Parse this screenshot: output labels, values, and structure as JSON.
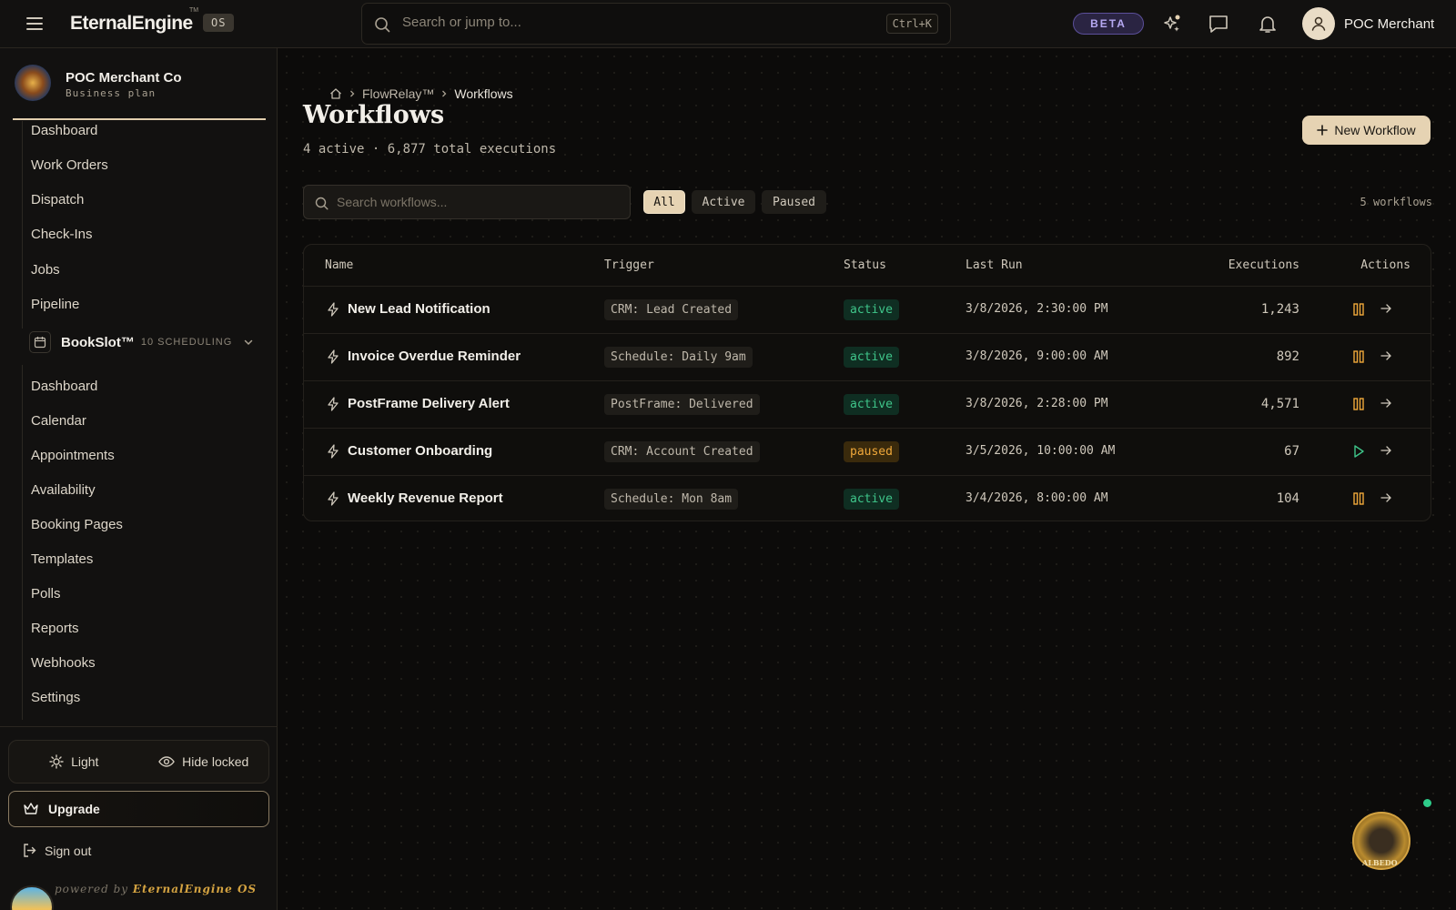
{
  "topbar": {
    "brand": "EternalEngine",
    "brand_tm": "TM",
    "os_badge": "OS",
    "search_placeholder": "Search or jump to...",
    "search_shortcut": "Ctrl+K",
    "beta": "BETA",
    "user_name": "POC Merchant"
  },
  "sidebar": {
    "org_name": "POC Merchant Co",
    "org_plan": "Business plan",
    "flowrelay_items": [
      "Dashboard",
      "Work Orders",
      "Dispatch",
      "Check-Ins",
      "Jobs",
      "Pipeline"
    ],
    "section": {
      "name": "BookSlot™",
      "sub": "10 SCHEDULING"
    },
    "bookslot_items": [
      "Dashboard",
      "Calendar",
      "Appointments",
      "Availability",
      "Booking Pages",
      "Templates",
      "Polls",
      "Reports",
      "Webhooks",
      "Settings"
    ],
    "toggle_light": "Light",
    "toggle_hide_locked": "Hide locked",
    "upgrade": "Upgrade",
    "signout": "Sign out",
    "powered_prefix": "powered by",
    "powered_brand": "EternalEngine OS"
  },
  "main": {
    "breadcrumb": [
      "FlowRelay™",
      "Workflows"
    ],
    "title": "Workflows",
    "subtitle": "4 active · 6,877 total executions",
    "new_button": "New Workflow",
    "search_placeholder": "Search workflows...",
    "filters": [
      "All",
      "Active",
      "Paused"
    ],
    "count": "5 workflows",
    "columns": {
      "name": "Name",
      "trigger": "Trigger",
      "status": "Status",
      "last_run": "Last Run",
      "executions": "Executions",
      "actions": "Actions"
    },
    "rows": [
      {
        "name": "New Lead Notification",
        "trigger": "CRM: Lead Created",
        "status": "active",
        "last_run": "3/8/2026, 2:30:00 PM",
        "executions": "1,243"
      },
      {
        "name": "Invoice Overdue Reminder",
        "trigger": "Schedule: Daily 9am",
        "status": "active",
        "last_run": "3/8/2026, 9:00:00 AM",
        "executions": "892"
      },
      {
        "name": "PostFrame Delivery Alert",
        "trigger": "PostFrame: Delivered",
        "status": "active",
        "last_run": "3/8/2026, 2:28:00 PM",
        "executions": "4,571"
      },
      {
        "name": "Customer Onboarding",
        "trigger": "CRM: Account Created",
        "status": "paused",
        "last_run": "3/5/2026, 10:00:00 AM",
        "executions": "67"
      },
      {
        "name": "Weekly Revenue Report",
        "trigger": "Schedule: Mon 8am",
        "status": "active",
        "last_run": "3/4/2026, 8:00:00 AM",
        "executions": "104"
      }
    ]
  },
  "assistant": {
    "label": "ALBEDO"
  },
  "colors": {
    "accent": "#e6d3b3",
    "active": "#3fc58a",
    "paused": "#f0a83a",
    "beta": "#b6a9f2"
  }
}
